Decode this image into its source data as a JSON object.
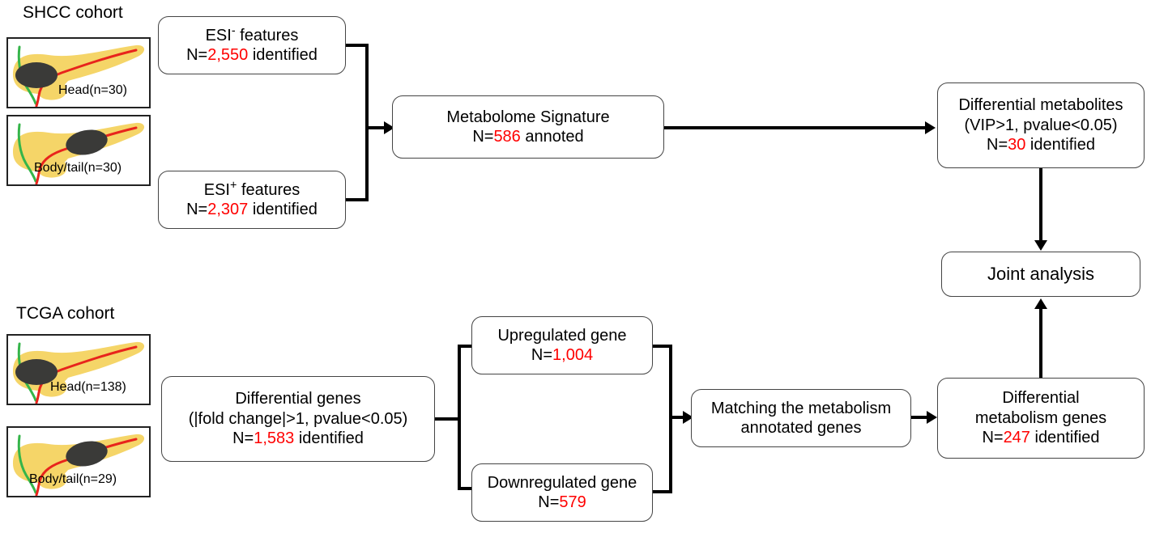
{
  "figure": {
    "type": "flowchart",
    "accent_red": "#ff0000",
    "pancreas_fill": "#f5d568",
    "duct_red": "#e8241c",
    "duct_green": "#35b54a",
    "tumor": "#3a3a38"
  },
  "cohorts": {
    "shcc": {
      "title": "SHCC cohort",
      "panels": [
        {
          "label": "Head(n=30)",
          "tumor_site": "head"
        },
        {
          "label": "Body/tail(n=30)",
          "tumor_site": "body"
        }
      ]
    },
    "tcga": {
      "title": "TCGA cohort",
      "panels": [
        {
          "label": "Head(n=138)",
          "tumor_site": "head"
        },
        {
          "label": "Body/tail(n=29)",
          "tumor_site": "body"
        }
      ]
    }
  },
  "boxes": {
    "esi_neg": {
      "line1_pre": "ESI",
      "line1_sup": "-",
      "line1_post": " features",
      "line2_pre": "N=",
      "line2_num": "2,550",
      "line2_post": " identified"
    },
    "esi_pos": {
      "line1_pre": "ESI",
      "line1_sup": "+",
      "line1_post": " features",
      "line2_pre": "N=",
      "line2_num": "2,307",
      "line2_post": " identified"
    },
    "metabolome": {
      "line1": "Metabolome  Signature",
      "line2_pre": "N=",
      "line2_num": "586",
      "line2_post": " annoted"
    },
    "diff_metabolites": {
      "line1": "Differential metabolites",
      "line2": "(VIP>1, pvalue<0.05)",
      "line3_pre": "N=",
      "line3_num": "30",
      "line3_post": " identified"
    },
    "joint": {
      "line1": "Joint analysis"
    },
    "diff_genes": {
      "line1": "Differential genes",
      "line2": "(|fold change|>1, pvalue<0.05)",
      "line3_pre": "N=",
      "line3_num": "1,583",
      "line3_post": " identified"
    },
    "upregulated": {
      "line1": "Upregulated  gene",
      "line2_pre": "N=",
      "line2_num": "1,004",
      "line2_post": ""
    },
    "downregulated": {
      "line1": "Downregulated  gene",
      "line2_pre": "N=",
      "line2_num": "579",
      "line2_post": ""
    },
    "matching": {
      "line1": "Matching the metabolism",
      "line2": "annotated genes"
    },
    "diff_metab_genes": {
      "line1": "Differential",
      "line2": "metabolism  genes",
      "line3_pre": "N=",
      "line3_num": "247",
      "line3_post": " identified"
    }
  }
}
